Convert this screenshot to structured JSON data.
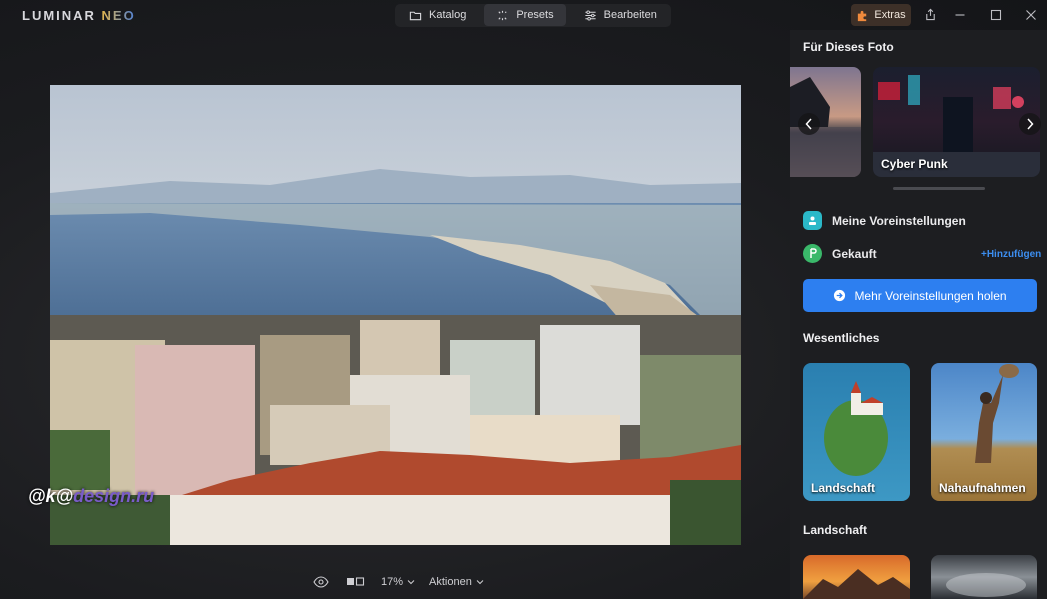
{
  "app": {
    "logo_main": "LUMINAR ",
    "logo_accent": "NEO"
  },
  "nav": {
    "katalog": "Katalog",
    "presets": "Presets",
    "bearbeiten": "Bearbeiten"
  },
  "titlebar": {
    "extras": "Extras"
  },
  "bottom": {
    "zoom": "17%",
    "actions": "Aktionen"
  },
  "watermark": {
    "prefix": "@k@",
    "suffix": "design.ru"
  },
  "panel": {
    "for_photo_title": "Für Dieses Foto",
    "carousel": [
      {
        "label": ""
      },
      {
        "label": "Cyber Punk"
      }
    ],
    "my_presets": "Meine Voreinstellungen",
    "purchased": "Gekauft",
    "add_link": "+Hinzufügen",
    "get_more": "Mehr Voreinstellungen holen",
    "essentials_title": "Wesentliches",
    "essentials": [
      {
        "label": "Landschaft"
      },
      {
        "label": "Nahaufnahmen"
      }
    ],
    "landscape_title": "Landschaft"
  },
  "colors": {
    "accent": "#2d7ff0",
    "link": "#3c8ef0",
    "extras_bg": "#3d3028"
  }
}
